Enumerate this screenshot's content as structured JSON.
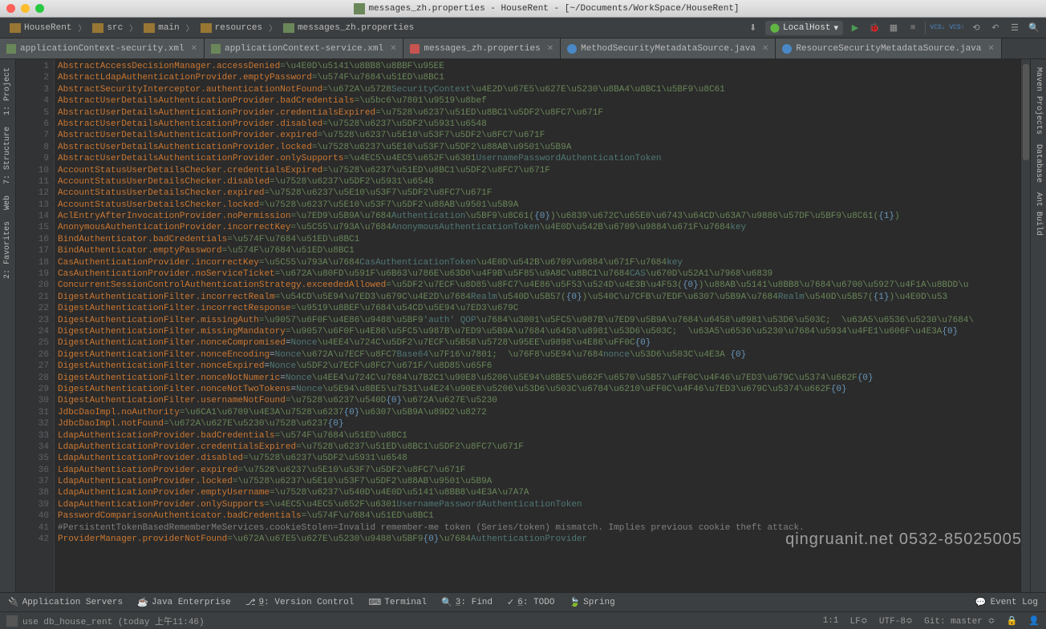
{
  "window": {
    "title": "messages_zh.properties - HouseRent - [~/Documents/WorkSpace/HouseRent]"
  },
  "breadcrumb": [
    "HouseRent",
    "src",
    "main",
    "resources",
    "messages_zh.properties"
  ],
  "run_config": {
    "label": "LocalHost"
  },
  "tabs": [
    {
      "label": "applicationContext-security.xml",
      "type": "xml"
    },
    {
      "label": "applicationContext-service.xml",
      "type": "xml"
    },
    {
      "label": "messages_zh.properties",
      "type": "prop",
      "active": true
    },
    {
      "label": "MethodSecurityMetadataSource.java",
      "type": "java"
    },
    {
      "label": "ResourceSecurityMetadataSource.java",
      "type": "java"
    }
  ],
  "left_tabs": [
    {
      "n": "1",
      "label": "Project"
    },
    {
      "n": "7",
      "label": "Structure"
    },
    {
      "n": "",
      "label": "Web"
    },
    {
      "n": "2",
      "label": "Favorites"
    }
  ],
  "right_tabs": [
    {
      "label": "Maven Projects"
    },
    {
      "label": "Database"
    },
    {
      "label": "Ant Build"
    }
  ],
  "bottom_tabs": [
    {
      "label": "Application Servers"
    },
    {
      "label": "Java Enterprise"
    },
    {
      "n": "9",
      "label": "Version Control"
    },
    {
      "label": "Terminal"
    },
    {
      "n": "3",
      "label": "Find"
    },
    {
      "n": "6",
      "label": "TODO"
    },
    {
      "label": "Spring"
    }
  ],
  "event_log": "Event Log",
  "status": {
    "msg": "use db_house_rent (today 上午11:46)",
    "pos": "1:1",
    "le": "LF≎",
    "enc": "UTF-8≎",
    "git": "Git: master ≎"
  },
  "watermark": "qingruanit.net 0532-85025005",
  "lines": [
    {
      "k": "AbstractAccessDecisionManager.accessDenied",
      "rest": [
        {
          "t": "=\\u4E0D\\u5141\\u8BB8\\u8BBF\\u95EE",
          "c": "v"
        }
      ]
    },
    {
      "k": "AbstractLdapAuthenticationProvider.emptyPassword",
      "rest": [
        {
          "t": "=\\u574F\\u7684\\u51ED\\u8BC1",
          "c": "v"
        }
      ]
    },
    {
      "k": "AbstractSecurityInterceptor.authenticationNotFound",
      "rest": [
        {
          "t": "=\\u672A\\u5728",
          "c": "v"
        },
        {
          "t": "SecurityContext",
          "c": "ref"
        },
        {
          "t": "\\u4E2D\\u67E5\\u627E\\u5230\\u8BA4\\u8BC1\\u5BF9\\u8C61",
          "c": "v"
        }
      ]
    },
    {
      "k": "AbstractUserDetailsAuthenticationProvider.badCredentials",
      "rest": [
        {
          "t": "=\\u5bc6\\u7801\\u9519\\u8bef",
          "c": "v"
        }
      ]
    },
    {
      "k": "AbstractUserDetailsAuthenticationProvider.credentialsExpired",
      "rest": [
        {
          "t": "=\\u7528\\u6237\\u51ED\\u8BC1\\u5DF2\\u8FC7\\u671F",
          "c": "v"
        }
      ]
    },
    {
      "k": "AbstractUserDetailsAuthenticationProvider.disabled",
      "rest": [
        {
          "t": "=\\u7528\\u6237\\u5DF2\\u5931\\u6548",
          "c": "v"
        }
      ]
    },
    {
      "k": "AbstractUserDetailsAuthenticationProvider.expired",
      "rest": [
        {
          "t": "=\\u7528\\u6237\\u5E10\\u53F7\\u5DF2\\u8FC7\\u671F",
          "c": "v"
        }
      ]
    },
    {
      "k": "AbstractUserDetailsAuthenticationProvider.locked",
      "rest": [
        {
          "t": "=\\u7528\\u6237\\u5E10\\u53F7\\u5DF2\\u88AB\\u9501\\u5B9A",
          "c": "v"
        }
      ]
    },
    {
      "k": "AbstractUserDetailsAuthenticationProvider.onlySupports",
      "rest": [
        {
          "t": "=\\u4EC5\\u4EC5\\u652F\\u6301",
          "c": "v"
        },
        {
          "t": "UsernamePasswordAuthenticationToken",
          "c": "ref"
        }
      ]
    },
    {
      "k": "AccountStatusUserDetailsChecker.credentialsExpired",
      "rest": [
        {
          "t": "=\\u7528\\u6237\\u51ED\\u8BC1\\u5DF2\\u8FC7\\u671F",
          "c": "v"
        }
      ]
    },
    {
      "k": "AccountStatusUserDetailsChecker.disabled",
      "rest": [
        {
          "t": "=\\u7528\\u6237\\u5DF2\\u5931\\u6548",
          "c": "v"
        }
      ]
    },
    {
      "k": "AccountStatusUserDetailsChecker.expired",
      "rest": [
        {
          "t": "=\\u7528\\u6237\\u5E10\\u53F7\\u5DF2\\u8FC7\\u671F",
          "c": "v"
        }
      ]
    },
    {
      "k": "AccountStatusUserDetailsChecker.locked",
      "rest": [
        {
          "t": "=\\u7528\\u6237\\u5E10\\u53F7\\u5DF2\\u88AB\\u9501\\u5B9A",
          "c": "v"
        }
      ]
    },
    {
      "k": "AclEntryAfterInvocationProvider.noPermission",
      "rest": [
        {
          "t": "=\\u7ED9\\u5B9A\\u7684",
          "c": "v"
        },
        {
          "t": "Authentication",
          "c": "ref"
        },
        {
          "t": "\\u5BF9\\u8C61(",
          "c": "v"
        },
        {
          "t": "{0}",
          "c": "p"
        },
        {
          "t": ")\\u6839\\u672C\\u65E0\\u6743\\u64CD\\u63A7\\u9886\\u57DF\\u5BF9\\u8C61(",
          "c": "v"
        },
        {
          "t": "{1}",
          "c": "p"
        },
        {
          "t": ")",
          "c": "v"
        }
      ]
    },
    {
      "k": "AnonymousAuthenticationProvider.incorrectKey",
      "rest": [
        {
          "t": "=\\u5C55\\u793A\\u7684",
          "c": "v"
        },
        {
          "t": "AnonymousAuthenticationToken",
          "c": "ref"
        },
        {
          "t": "\\u4E0D\\u542B\\u6709\\u9884\\u671F\\u7684",
          "c": "v"
        },
        {
          "t": "key",
          "c": "ref"
        }
      ]
    },
    {
      "k": "BindAuthenticator.badCredentials",
      "rest": [
        {
          "t": "=\\u574F\\u7684\\u51ED\\u8BC1",
          "c": "v"
        }
      ]
    },
    {
      "k": "BindAuthenticator.emptyPassword",
      "rest": [
        {
          "t": "=\\u574F\\u7684\\u51ED\\u8BC1",
          "c": "v"
        }
      ]
    },
    {
      "k": "CasAuthenticationProvider.incorrectKey",
      "rest": [
        {
          "t": "=\\u5C55\\u793A\\u7684",
          "c": "v"
        },
        {
          "t": "CasAuthenticationToken",
          "c": "ref"
        },
        {
          "t": "\\u4E0D\\u542B\\u6709\\u9884\\u671F\\u7684",
          "c": "v"
        },
        {
          "t": "key",
          "c": "ref"
        }
      ]
    },
    {
      "k": "CasAuthenticationProvider.noServiceTicket",
      "rest": [
        {
          "t": "=\\u672A\\u80FD\\u591F\\u6B63\\u786E\\u63D0\\u4F9B\\u5F85\\u9A8C\\u8BC1\\u7684",
          "c": "v"
        },
        {
          "t": "CAS",
          "c": "ref"
        },
        {
          "t": "\\u670D\\u52A1\\u7968\\u6839",
          "c": "v"
        }
      ]
    },
    {
      "k": "ConcurrentSessionControlAuthenticationStrategy.exceededAllowed",
      "rest": [
        {
          "t": "=\\u5DF2\\u7ECF\\u8D85\\u8FC7\\u4E86\\u5F53\\u524D\\u4E3B\\u4F53(",
          "c": "v"
        },
        {
          "t": "{0}",
          "c": "p"
        },
        {
          "t": ")\\u88AB\\u5141\\u8BB8\\u7684\\u6700\\u5927\\u4F1A\\u8BDD\\u",
          "c": "v"
        }
      ]
    },
    {
      "k": "DigestAuthenticationFilter.incorrectRealm",
      "rest": [
        {
          "t": "=\\u54CD\\u5E94\\u7ED3\\u679C\\u4E2D\\u7684",
          "c": "v"
        },
        {
          "t": "Realm",
          "c": "ref"
        },
        {
          "t": "\\u540D\\u5B57(",
          "c": "v"
        },
        {
          "t": "{0}",
          "c": "p"
        },
        {
          "t": ")\\u540C\\u7CFB\\u7EDF\\u6307\\u5B9A\\u7684",
          "c": "v"
        },
        {
          "t": "Realm",
          "c": "ref"
        },
        {
          "t": "\\u540D\\u5B57(",
          "c": "v"
        },
        {
          "t": "{1}",
          "c": "p"
        },
        {
          "t": ")\\u4E0D\\u53",
          "c": "v"
        }
      ]
    },
    {
      "k": "DigestAuthenticationFilter.incorrectResponse",
      "rest": [
        {
          "t": "=\\u9519\\u8BEF\\u7684\\u54CD\\u5E94\\u7ED3\\u679C",
          "c": "v"
        }
      ]
    },
    {
      "k": "DigestAuthenticationFilter.missingAuth",
      "rest": [
        {
          "t": "=\\u9057\\u6F0F\\u4E86\\u9488\\u5BF9",
          "c": "v"
        },
        {
          "t": "'auth' QOP",
          "c": "ref"
        },
        {
          "t": "\\u7684\\u3001\\u5FC5\\u987B\\u7ED9\\u5B9A\\u7684\\u6458\\u8981\\u53D6\\u503C;  \\u63A5\\u6536\\u5230\\u7684\\",
          "c": "v"
        }
      ]
    },
    {
      "k": "DigestAuthenticationFilter.missingMandatory",
      "rest": [
        {
          "t": "=\\u9057\\u6F0F\\u4E86\\u5FC5\\u987B\\u7ED9\\u5B9A\\u7684\\u6458\\u8981\\u53D6\\u503C;  \\u63A5\\u6536\\u5230\\u7684\\u5934\\u4FE1\\u606F\\u4E3A",
          "c": "v"
        },
        {
          "t": "{0}",
          "c": "p"
        }
      ]
    },
    {
      "k": "DigestAuthenticationFilter.nonceCompromised",
      "rest": [
        {
          "t": "=",
          "c": "eq"
        },
        {
          "t": "Nonce",
          "c": "ref"
        },
        {
          "t": "\\u4EE4\\u724C\\u5DF2\\u7ECF\\u5B58\\u5728\\u95EE\\u9898\\u4E86\\uFF0C",
          "c": "v"
        },
        {
          "t": "{0}",
          "c": "p"
        }
      ]
    },
    {
      "k": "DigestAuthenticationFilter.nonceEncoding",
      "rest": [
        {
          "t": "=",
          "c": "eq"
        },
        {
          "t": "Nonce",
          "c": "ref"
        },
        {
          "t": "\\u672A\\u7ECF\\u8FC7",
          "c": "v"
        },
        {
          "t": "Base64",
          "c": "ref"
        },
        {
          "t": "\\u7F16\\u7801;  \\u76F8\\u5E94\\u7684",
          "c": "v"
        },
        {
          "t": "nonce",
          "c": "ref"
        },
        {
          "t": "\\u53D6\\u503C\\u4E3A ",
          "c": "v"
        },
        {
          "t": "{0}",
          "c": "p"
        }
      ]
    },
    {
      "k": "DigestAuthenticationFilter.nonceExpired",
      "rest": [
        {
          "t": "=",
          "c": "eq"
        },
        {
          "t": "Nonce",
          "c": "ref"
        },
        {
          "t": "\\u5DF2\\u7ECF\\u8FC7\\u671F/\\u8D85\\u65F6",
          "c": "v"
        }
      ]
    },
    {
      "k": "DigestAuthenticationFilter.nonceNotNumeric",
      "rest": [
        {
          "t": "=",
          "c": "eq"
        },
        {
          "t": "Nonce",
          "c": "ref"
        },
        {
          "t": "\\u4EE4\\u724C\\u7684\\u7B2C1\\u90E8\\u5206\\u5E94\\u8BE5\\u662F\\u6570\\u5B57\\uFF0C\\u4F46\\u7ED3\\u679C\\u5374\\u662F",
          "c": "v"
        },
        {
          "t": "{0}",
          "c": "p"
        }
      ]
    },
    {
      "k": "DigestAuthenticationFilter.nonceNotTwoTokens",
      "rest": [
        {
          "t": "=",
          "c": "eq"
        },
        {
          "t": "Nonce",
          "c": "ref"
        },
        {
          "t": "\\u5E94\\u8BE5\\u7531\\u4E24\\u90E8\\u5206\\u53D6\\u503C\\u6784\\u6210\\uFF0C\\u4F46\\u7ED3\\u679C\\u5374\\u662F",
          "c": "v"
        },
        {
          "t": "{0}",
          "c": "p"
        }
      ]
    },
    {
      "k": "DigestAuthenticationFilter.usernameNotFound",
      "rest": [
        {
          "t": "=\\u7528\\u6237\\u540D",
          "c": "v"
        },
        {
          "t": "{0}",
          "c": "p"
        },
        {
          "t": "\\u672A\\u627E\\u5230",
          "c": "v"
        }
      ]
    },
    {
      "k": "JdbcDaoImpl.noAuthority",
      "rest": [
        {
          "t": "=\\u6CA1\\u6709\\u4E3A\\u7528\\u6237",
          "c": "v"
        },
        {
          "t": "{0}",
          "c": "p"
        },
        {
          "t": "\\u6307\\u5B9A\\u89D2\\u8272",
          "c": "v"
        }
      ]
    },
    {
      "k": "JdbcDaoImpl.notFound",
      "rest": [
        {
          "t": "=\\u672A\\u627E\\u5230\\u7528\\u6237",
          "c": "v"
        },
        {
          "t": "{0}",
          "c": "p"
        }
      ]
    },
    {
      "k": "LdapAuthenticationProvider.badCredentials",
      "rest": [
        {
          "t": "=\\u574F\\u7684\\u51ED\\u8BC1",
          "c": "v"
        }
      ]
    },
    {
      "k": "LdapAuthenticationProvider.credentialsExpired",
      "rest": [
        {
          "t": "=\\u7528\\u6237\\u51ED\\u8BC1\\u5DF2\\u8FC7\\u671F",
          "c": "v"
        }
      ]
    },
    {
      "k": "LdapAuthenticationProvider.disabled",
      "rest": [
        {
          "t": "=\\u7528\\u6237\\u5DF2\\u5931\\u6548",
          "c": "v"
        }
      ]
    },
    {
      "k": "LdapAuthenticationProvider.expired",
      "rest": [
        {
          "t": "=\\u7528\\u6237\\u5E10\\u53F7\\u5DF2\\u8FC7\\u671F",
          "c": "v"
        }
      ]
    },
    {
      "k": "LdapAuthenticationProvider.locked",
      "rest": [
        {
          "t": "=\\u7528\\u6237\\u5E10\\u53F7\\u5DF2\\u88AB\\u9501\\u5B9A",
          "c": "v"
        }
      ]
    },
    {
      "k": "LdapAuthenticationProvider.emptyUsername",
      "rest": [
        {
          "t": "=\\u7528\\u6237\\u540D\\u4E0D\\u5141\\u8BB8\\u4E3A\\u7A7A",
          "c": "v"
        }
      ]
    },
    {
      "k": "LdapAuthenticationProvider.onlySupports",
      "rest": [
        {
          "t": "=\\u4EC5\\u4EC5\\u652F\\u6301",
          "c": "v"
        },
        {
          "t": "UsernamePasswordAuthenticationToken",
          "c": "ref"
        }
      ]
    },
    {
      "k": "PasswordComparisonAuthenticator.badCredentials",
      "rest": [
        {
          "t": "=\\u574F\\u7684\\u51ED\\u8BC1",
          "c": "v"
        }
      ]
    },
    {
      "comment": "#PersistentTokenBasedRememberMeServices.cookieStolen=Invalid remember-me token (Series/token) mismatch. Implies previous cookie theft attack."
    },
    {
      "k": "ProviderManager.providerNotFound",
      "rest": [
        {
          "t": "=\\u672A\\u67E5\\u627E\\u5230\\u9488\\u5BF9",
          "c": "v"
        },
        {
          "t": "{0}",
          "c": "p"
        },
        {
          "t": "\\u7684",
          "c": "v"
        },
        {
          "t": "AuthenticationProvider",
          "c": "ref"
        }
      ]
    }
  ]
}
